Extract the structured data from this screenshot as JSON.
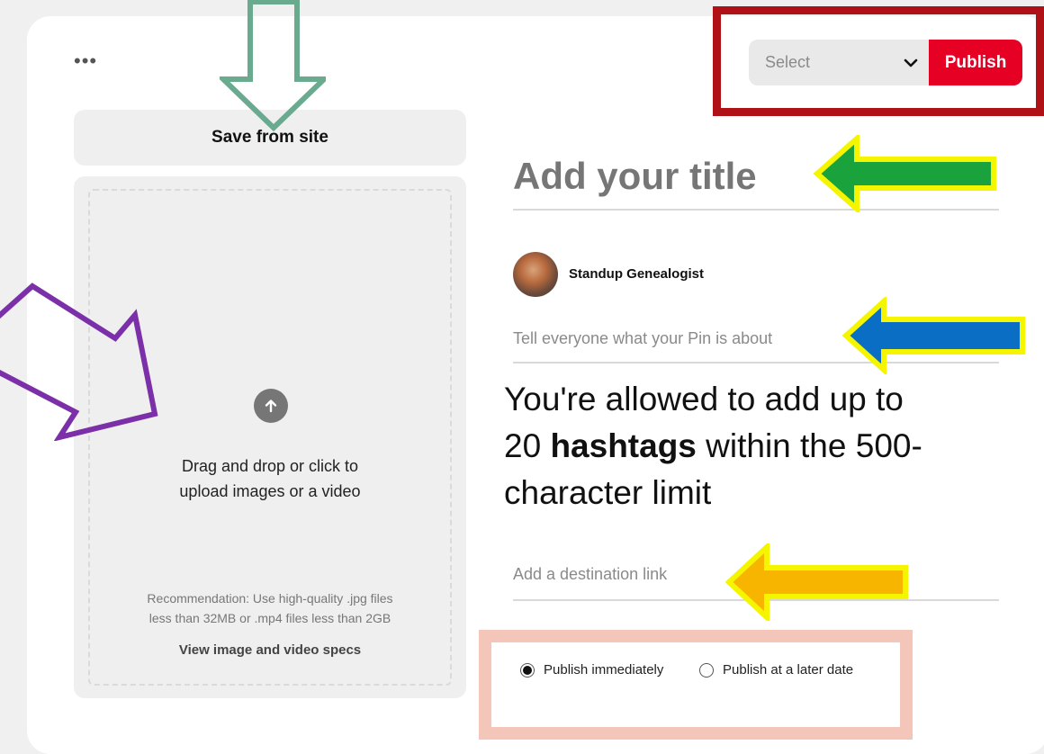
{
  "menu": {
    "more_glyph": "•••"
  },
  "upload": {
    "save_from_site": "Save from site",
    "instruction_line1": "Drag and drop or click to",
    "instruction_line2": "upload images or a video",
    "recommendation_line1": "Recommendation: Use high-quality .jpg files",
    "recommendation_line2": "less than 32MB or .mp4 files less than 2GB",
    "specs_link": "View image and video specs"
  },
  "header": {
    "board_select_placeholder": "Select",
    "publish_label": "Publish"
  },
  "form": {
    "title_placeholder": "Add your title",
    "username": "Standup Genealogist",
    "description_placeholder": "Tell everyone what your Pin is about",
    "link_placeholder": "Add a destination link"
  },
  "annotation": {
    "line1": "You're allowed to add up to",
    "line2_prefix": "20 ",
    "line2_bold": "hashtags",
    "line2_suffix": " within the 500-",
    "line3": "character limit"
  },
  "publish_options": [
    {
      "label": "Publish immediately",
      "selected": true
    },
    {
      "label": "Publish at a later date",
      "selected": false
    }
  ],
  "colors": {
    "publish_red": "#e60023",
    "frame_red": "#b01116",
    "frame_pink": "#f4c6b9",
    "arrow_teal": "#6aaa8e",
    "arrow_purple": "#7b2fa8",
    "arrow_green": "#1aa33c",
    "arrow_blue": "#0a6ec4",
    "arrow_orange": "#f7b500",
    "arrow_outline_yellow": "#f5f500"
  },
  "icons": [
    "more-dots-icon",
    "upload-arrow-icon",
    "chevron-down-icon"
  ]
}
